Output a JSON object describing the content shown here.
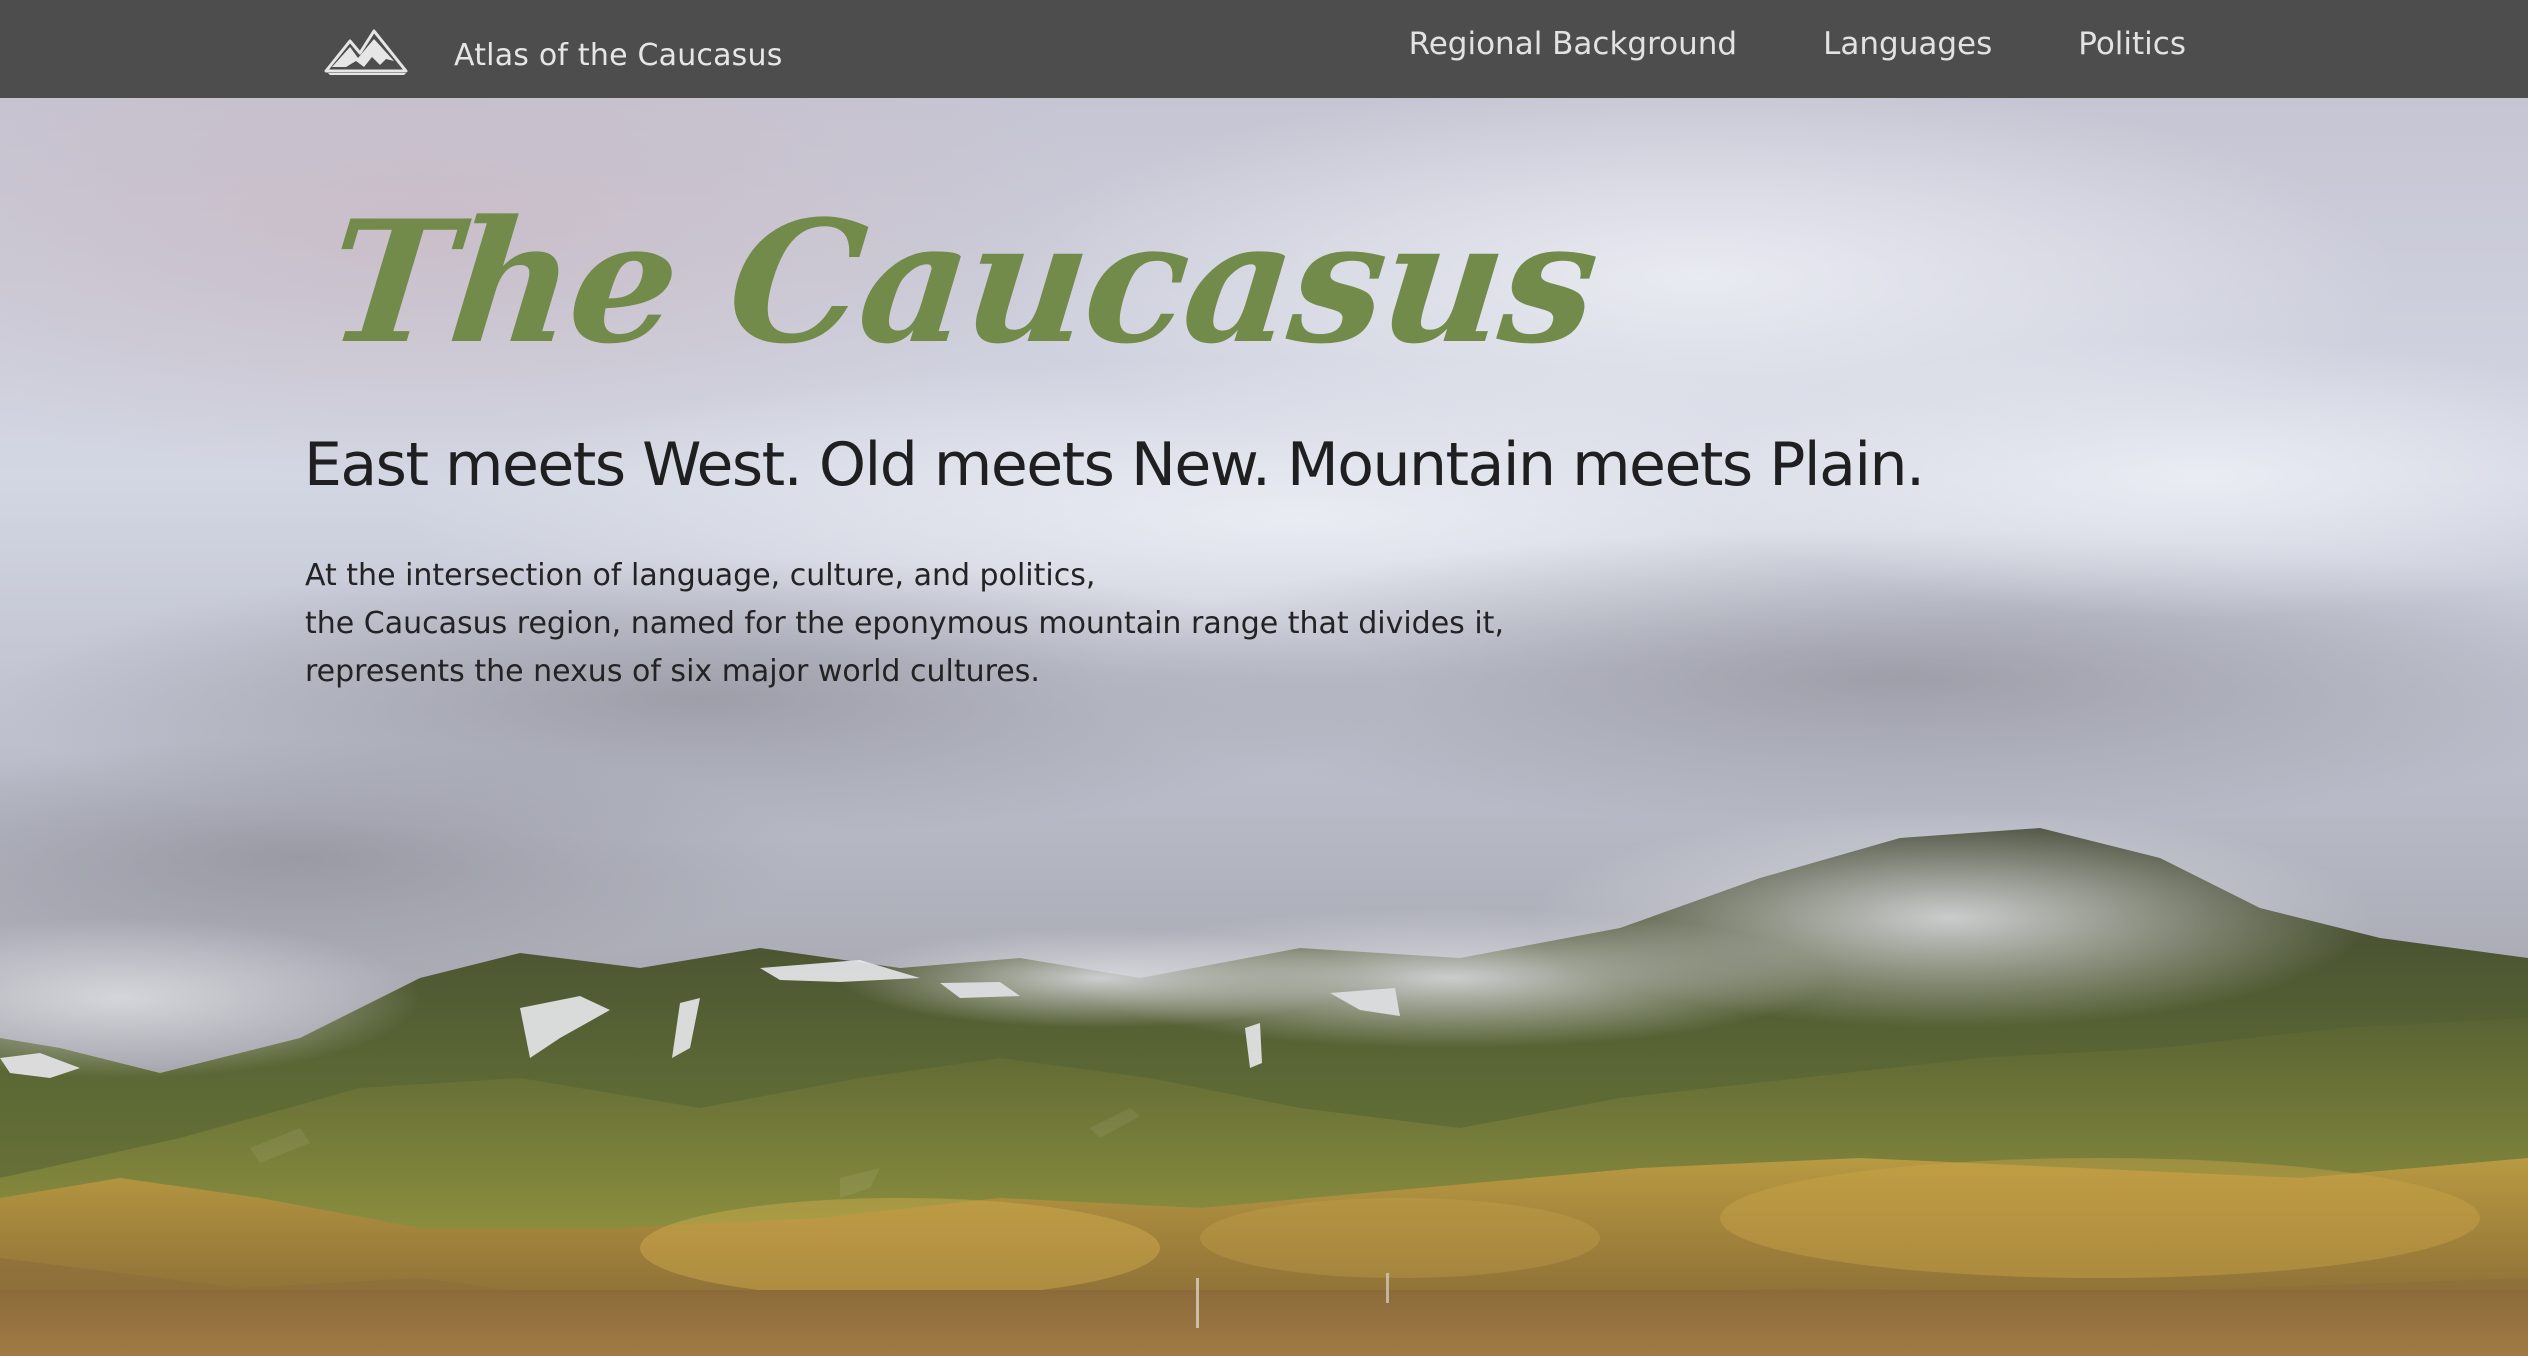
{
  "site": {
    "brand_name": "Atlas of the Caucasus",
    "logo_icon": "mountain-logo-icon"
  },
  "nav": {
    "items": [
      {
        "label": "Regional Background"
      },
      {
        "label": "Languages"
      },
      {
        "label": "Politics"
      }
    ]
  },
  "hero": {
    "title": "The Caucasus",
    "tagline": "East meets West. Old meets New. Mountain meets Plain.",
    "body_lines": [
      "At the intersection of language, culture, and politics,",
      "the Caucasus region, named for the eponymous mountain range that divides it,",
      "represents the nexus of six major world cultures."
    ]
  },
  "colors": {
    "navbar_bg": "#4d4d4e",
    "nav_text": "#e2e2e2",
    "title_green": "#728a4a",
    "body_text": "#232325"
  }
}
